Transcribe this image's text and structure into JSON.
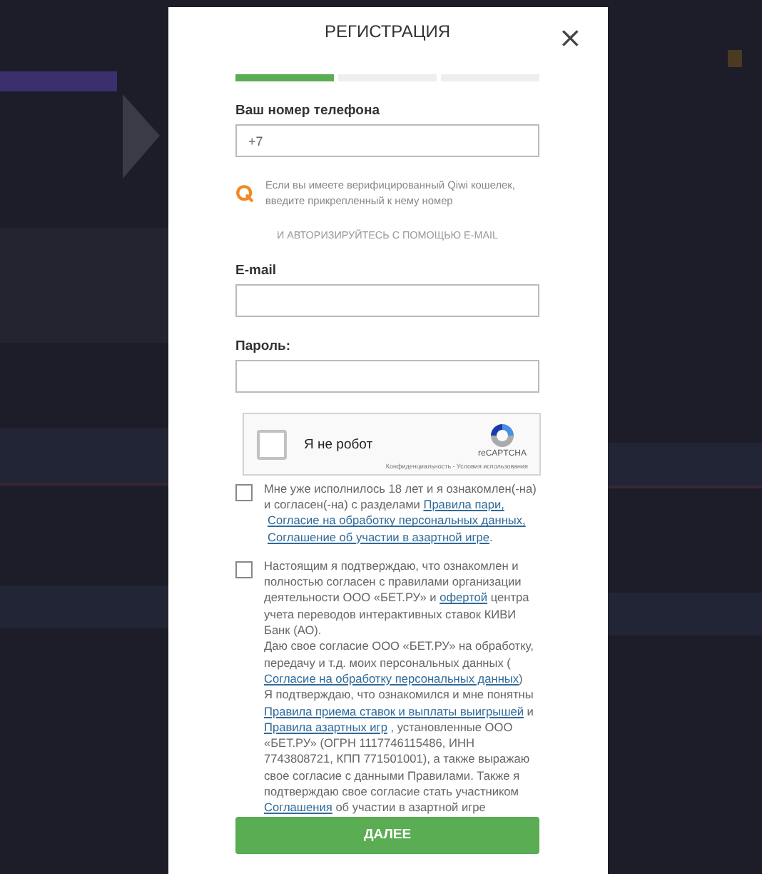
{
  "dialog": {
    "title": "РЕГИСТРАЦИЯ",
    "close": "×",
    "steps": [
      {
        "active": true
      },
      {
        "active": false
      },
      {
        "active": false
      }
    ],
    "phone": {
      "label": "Ваш номер телефона",
      "value": "+7"
    },
    "qiwi_hint": "Если вы имеете верифицированный Qiwi кошелек, введите прикрепленный к нему номер",
    "email_divider": "И АВТОРИЗИРУЙТЕСЬ С ПОМОЩЬЮ E-MAIL",
    "email": {
      "label": "E-mail"
    },
    "password": {
      "label": "Пароль:"
    },
    "captcha": {
      "label": "Я не робот",
      "checked": false,
      "brand": "reCAPTCHA",
      "terms": "Конфиденциальность - Условия использования"
    },
    "consents": [
      {
        "checked": false,
        "parts": [
          {
            "text": "Мне уже исполнилось 18 лет и я ознакомлен(-на) и согласен(-на) с разделами ",
            "kind": "text"
          },
          {
            "text": "Правила пари,",
            "kind": "link"
          },
          {
            "text": "Согласие на обработку персональных данных,",
            "kind": "link"
          },
          {
            "text": "Соглашение об участии в азартной игре",
            "kind": "link"
          },
          {
            "text": ".",
            "kind": "text"
          }
        ]
      },
      {
        "checked": false,
        "parts": [
          {
            "text": "Настоящим я подтверждаю, что ознакомлен и полностью согласен с правилами организации деятельности ООО «БЕТ.РУ» и ",
            "kind": "text"
          },
          {
            "text": "офертой",
            "kind": "link"
          },
          {
            "text": " центра учета переводов интерактивных ставок КИВИ Банк (АО).\nДаю свое согласие ООО «БЕТ.РУ» на обработку, передачу и т.д. моих персональных данных (",
            "kind": "text"
          },
          {
            "text": "Согласие на обработку персональных данных",
            "kind": "link"
          },
          {
            "text": ")\nЯ подтверждаю, что ознакомился и мне понятны ",
            "kind": "text"
          },
          {
            "text": "Правила приема ставок и выплаты выигрышей",
            "kind": "link"
          },
          {
            "text": " и ",
            "kind": "text"
          },
          {
            "text": "Правила азартных игр",
            "kind": "link"
          },
          {
            "text": " , установленные ООО «БЕТ.РУ» (ОГРН 1117746115486, ИНН 7743808721, КПП 771501001), а также выражаю свое согласие с данными Правилами. Также я подтверждаю свое согласие стать участником ",
            "kind": "text"
          },
          {
            "text": "Соглашения",
            "kind": "link"
          },
          {
            "text": " об участии в азартной игре",
            "kind": "text"
          }
        ]
      }
    ],
    "submit": "ДАЛЕЕ"
  }
}
